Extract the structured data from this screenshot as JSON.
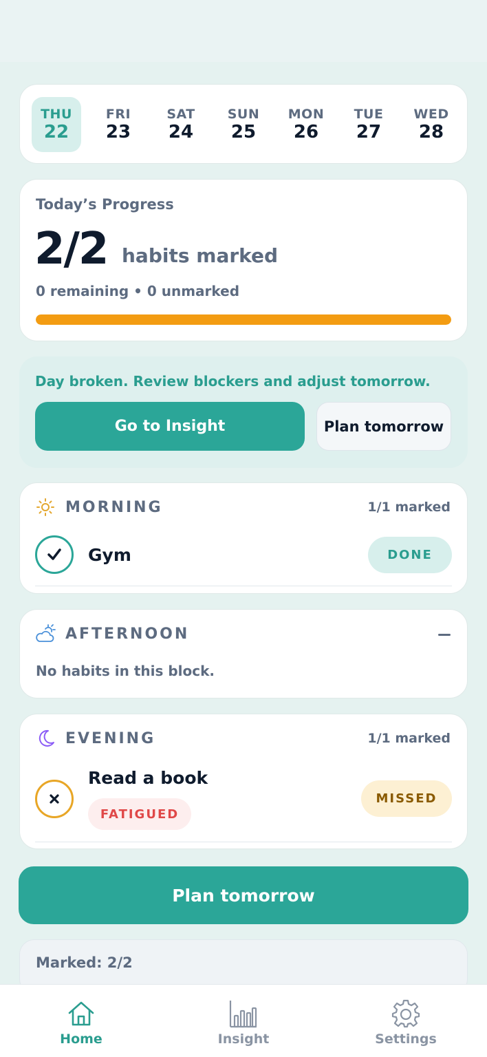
{
  "week": [
    {
      "day": "THU",
      "num": "22",
      "active": true
    },
    {
      "day": "FRI",
      "num": "23"
    },
    {
      "day": "SAT",
      "num": "24"
    },
    {
      "day": "SUN",
      "num": "25"
    },
    {
      "day": "MON",
      "num": "26"
    },
    {
      "day": "TUE",
      "num": "27"
    },
    {
      "day": "WED",
      "num": "28"
    }
  ],
  "progress": {
    "title": "Today’s Progress",
    "count": "2/2",
    "label": "habits marked",
    "sub": "0 remaining • 0 unmarked",
    "fraction": 1.0,
    "bar_color": "#f39c12"
  },
  "banner": {
    "text": "Day broken. Review blockers and adjust tomorrow.",
    "primary_label": "Go to Insight",
    "secondary_label": "Plan tomorrow"
  },
  "blocks": {
    "morning": {
      "icon": "sun-icon",
      "title": "MORNING",
      "count": "1/1 marked",
      "habit": {
        "name": "Gym",
        "status": "DONE",
        "status_icon": "check-icon"
      }
    },
    "afternoon": {
      "icon": "cloud-sun-icon",
      "title": "AFTERNOON",
      "empty": "No habits in this block."
    },
    "evening": {
      "icon": "moon-icon",
      "title": "EVENING",
      "count": "1/1 marked",
      "habit": {
        "name": "Read a book",
        "tag": "FATIGUED",
        "status": "MISSED",
        "status_icon": "x-icon"
      }
    }
  },
  "plan_button": "Plan tomorrow",
  "marked_summary": "Marked: 2/2",
  "tabs": [
    {
      "label": "Home",
      "icon": "home-icon",
      "active": true
    },
    {
      "label": "Insight",
      "icon": "bar-chart-icon"
    },
    {
      "label": "Settings",
      "icon": "gear-icon"
    }
  ],
  "colors": {
    "accent": "#2ba698",
    "missed_bg": "#fdf0d3",
    "missed_text": "#8a5a00",
    "fatigued_bg": "#fdeeee",
    "fatigued_text": "#e04848"
  }
}
